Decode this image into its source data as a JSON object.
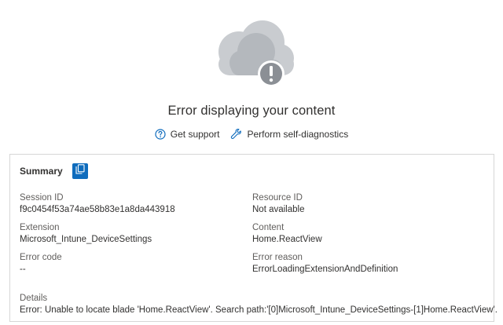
{
  "error": {
    "title": "Error displaying your content",
    "status_icon": "cloud-warning-icon"
  },
  "actions": {
    "get_support": "Get support",
    "self_diagnostics": "Perform self-diagnostics"
  },
  "summary": {
    "title": "Summary",
    "fields": {
      "session_id": {
        "label": "Session ID",
        "value": "f9c0454f53a74ae58b83e1a8da443918"
      },
      "resource_id": {
        "label": "Resource ID",
        "value": "Not available"
      },
      "extension": {
        "label": "Extension",
        "value": "Microsoft_Intune_DeviceSettings"
      },
      "content": {
        "label": "Content",
        "value": "Home.ReactView"
      },
      "error_code": {
        "label": "Error code",
        "value": "--"
      },
      "error_reason": {
        "label": "Error reason",
        "value": "ErrorLoadingExtensionAndDefinition"
      },
      "details": {
        "label": "Details",
        "value": "Error: Unable to locate blade 'Home.ReactView'. Search path:'[0]Microsoft_Intune_DeviceSettings-[1]Home.ReactView'."
      }
    }
  },
  "colors": {
    "cloud_light": "#c8cbcf",
    "cloud_dark": "#a9adb3",
    "warning_badge": "#8a8e94",
    "accent": "#0f6cbd"
  }
}
